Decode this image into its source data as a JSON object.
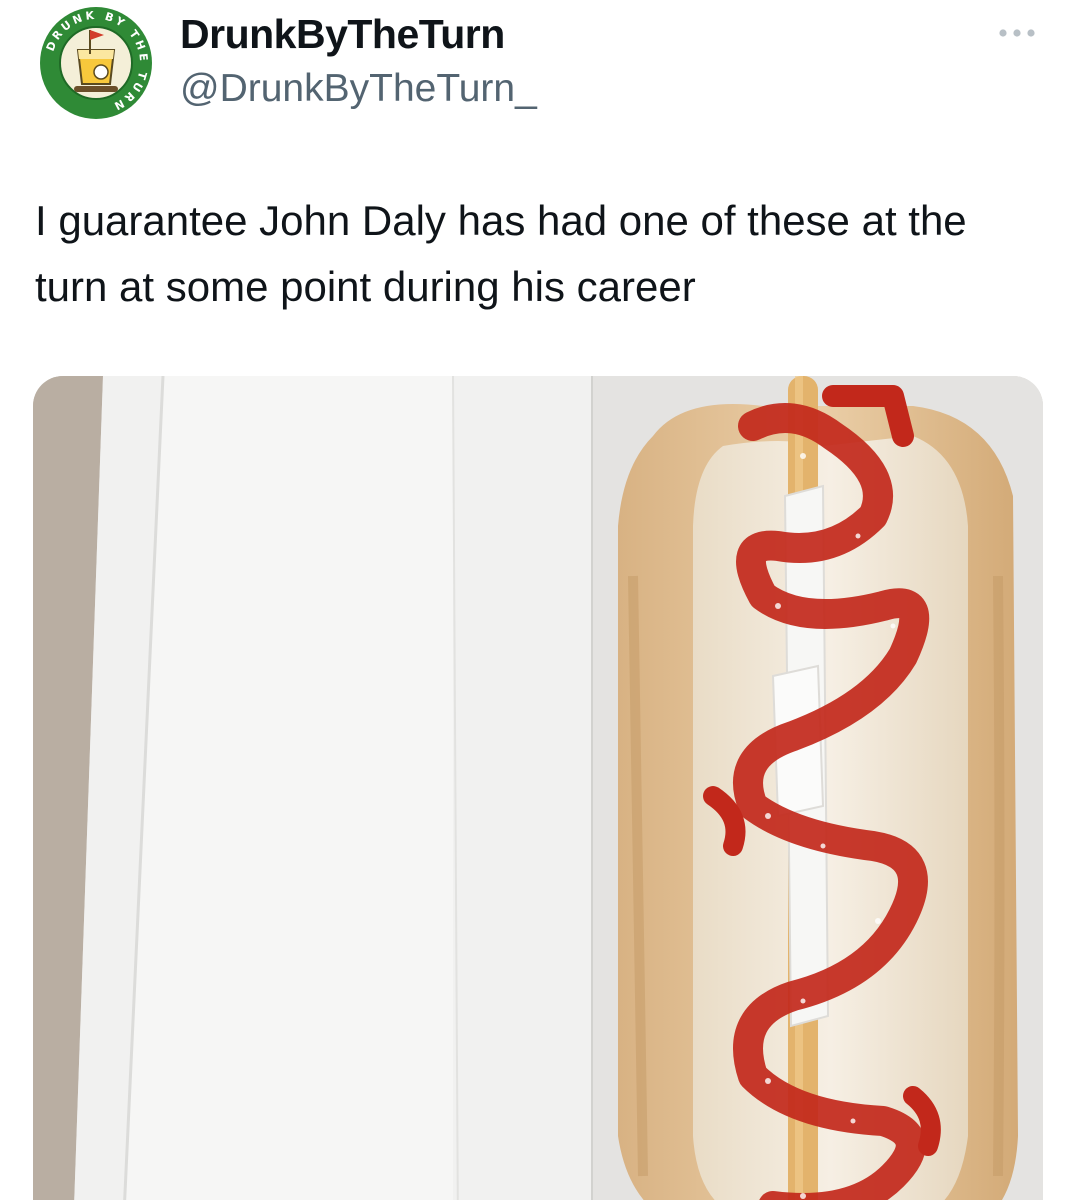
{
  "author": {
    "display_name": "DrunkByTheTurn",
    "handle": "@DrunkByTheTurn_",
    "avatar_icon": "golf-cocktail-logo-icon",
    "avatar_ring_text": "DRUNK BY THE TURN",
    "brand_color": "#2f8a36"
  },
  "tweet": {
    "text": "I guarantee John Daly has had one of these at the turn at some point during his career"
  },
  "actions": {
    "more_icon": "more-horizontal-icon"
  },
  "media": {
    "icon": "hot-dog-photo",
    "colors": {
      "box": "#ececea",
      "bun": "#e2c196",
      "crumb": "#f3ece0",
      "ketchup": "#c2281b",
      "stick": "#e3b36c"
    }
  }
}
